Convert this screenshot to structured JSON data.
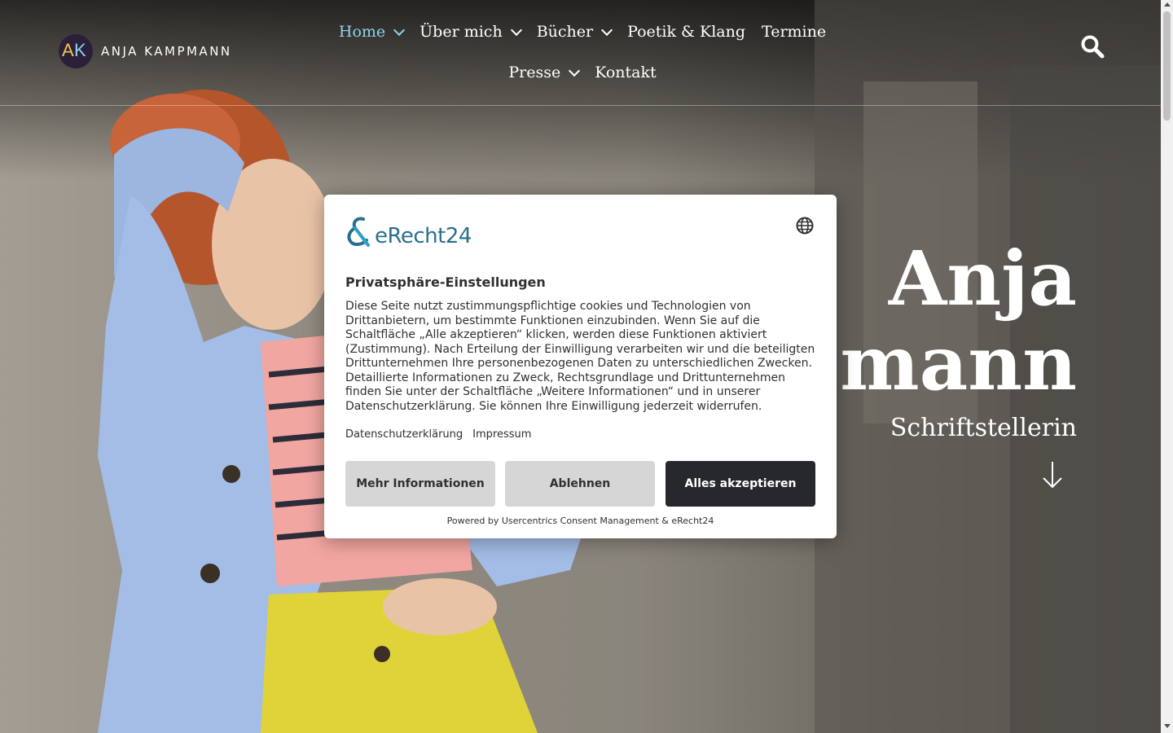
{
  "site": {
    "logo_initials_a": "A",
    "logo_initials_k": "K",
    "logo_text": "ANJA KAMPMANN"
  },
  "nav": {
    "row1": [
      {
        "label": "Home",
        "has_dropdown": true,
        "active": true
      },
      {
        "label": "Über mich",
        "has_dropdown": true
      },
      {
        "label": "Bücher",
        "has_dropdown": true
      },
      {
        "label": "Poetik & Klang",
        "has_dropdown": false
      },
      {
        "label": "Termine",
        "has_dropdown": false
      }
    ],
    "row2": [
      {
        "label": "Presse",
        "has_dropdown": true
      },
      {
        "label": "Kontakt",
        "has_dropdown": false
      }
    ],
    "search_icon": "search-icon"
  },
  "hero": {
    "title_line1": "Anja",
    "title_line2": "mann",
    "subtitle": "Schriftstellerin",
    "arrow_icon": "arrow-down-icon"
  },
  "consent": {
    "brand": "eRecht24",
    "title": "Privatsphäre-Einstellungen",
    "body": "Diese Seite nutzt zustimmungspflichtige cookies und Technologien von Drittanbietern, um bestimmte Funktionen einzubinden. Wenn Sie auf die Schaltfläche „Alle akzeptieren“ klicken, werden diese Funktionen aktiviert (Zustimmung). Nach Erteilung der Einwilligung verarbeiten wir und die beteiligten Drittunternehmen Ihre personenbezogenen Daten zu unterschiedlichen Zwecken. Detaillierte Informationen zu Zweck, Rechtsgrundlage und Drittunternehmen finden Sie unter der Schaltfläche „Weitere Informationen“ und in unserer Datenschutzerklärung. Sie können Ihre Einwilligung jederzeit widerrufen.",
    "link_privacy": "Datenschutzerklärung",
    "link_imprint": "Impressum",
    "btn_more": "Mehr Informationen",
    "btn_deny": "Ablehnen",
    "btn_accept": "Alles akzeptieren",
    "powered_by": "Powered by Usercentrics Consent Management & eRecht24",
    "language_icon": "globe-icon"
  },
  "colors": {
    "nav_active": "#8fd3e8",
    "accept_button": "#27282b",
    "secondary_button": "#d6d6d6",
    "brand_blue": "#2a6f8f"
  }
}
